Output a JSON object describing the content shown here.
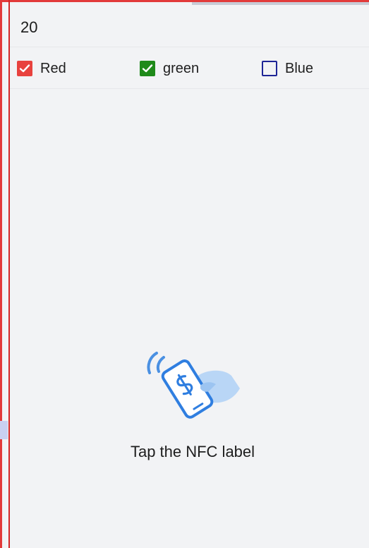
{
  "header": {
    "value": "20"
  },
  "options": [
    {
      "label": "Red",
      "checked": true,
      "color": "#e8423e"
    },
    {
      "label": "green",
      "checked": true,
      "color": "#1f8a1a"
    },
    {
      "label": "Blue",
      "checked": false,
      "color": "#1e2596"
    }
  ],
  "nfc": {
    "icon": "nfc-pay-icon",
    "prompt": "Tap the NFC label"
  },
  "colors": {
    "background": "#f2f3f5",
    "frame_border": "#e23a3a",
    "illustration_blue": "#4a90e2"
  }
}
